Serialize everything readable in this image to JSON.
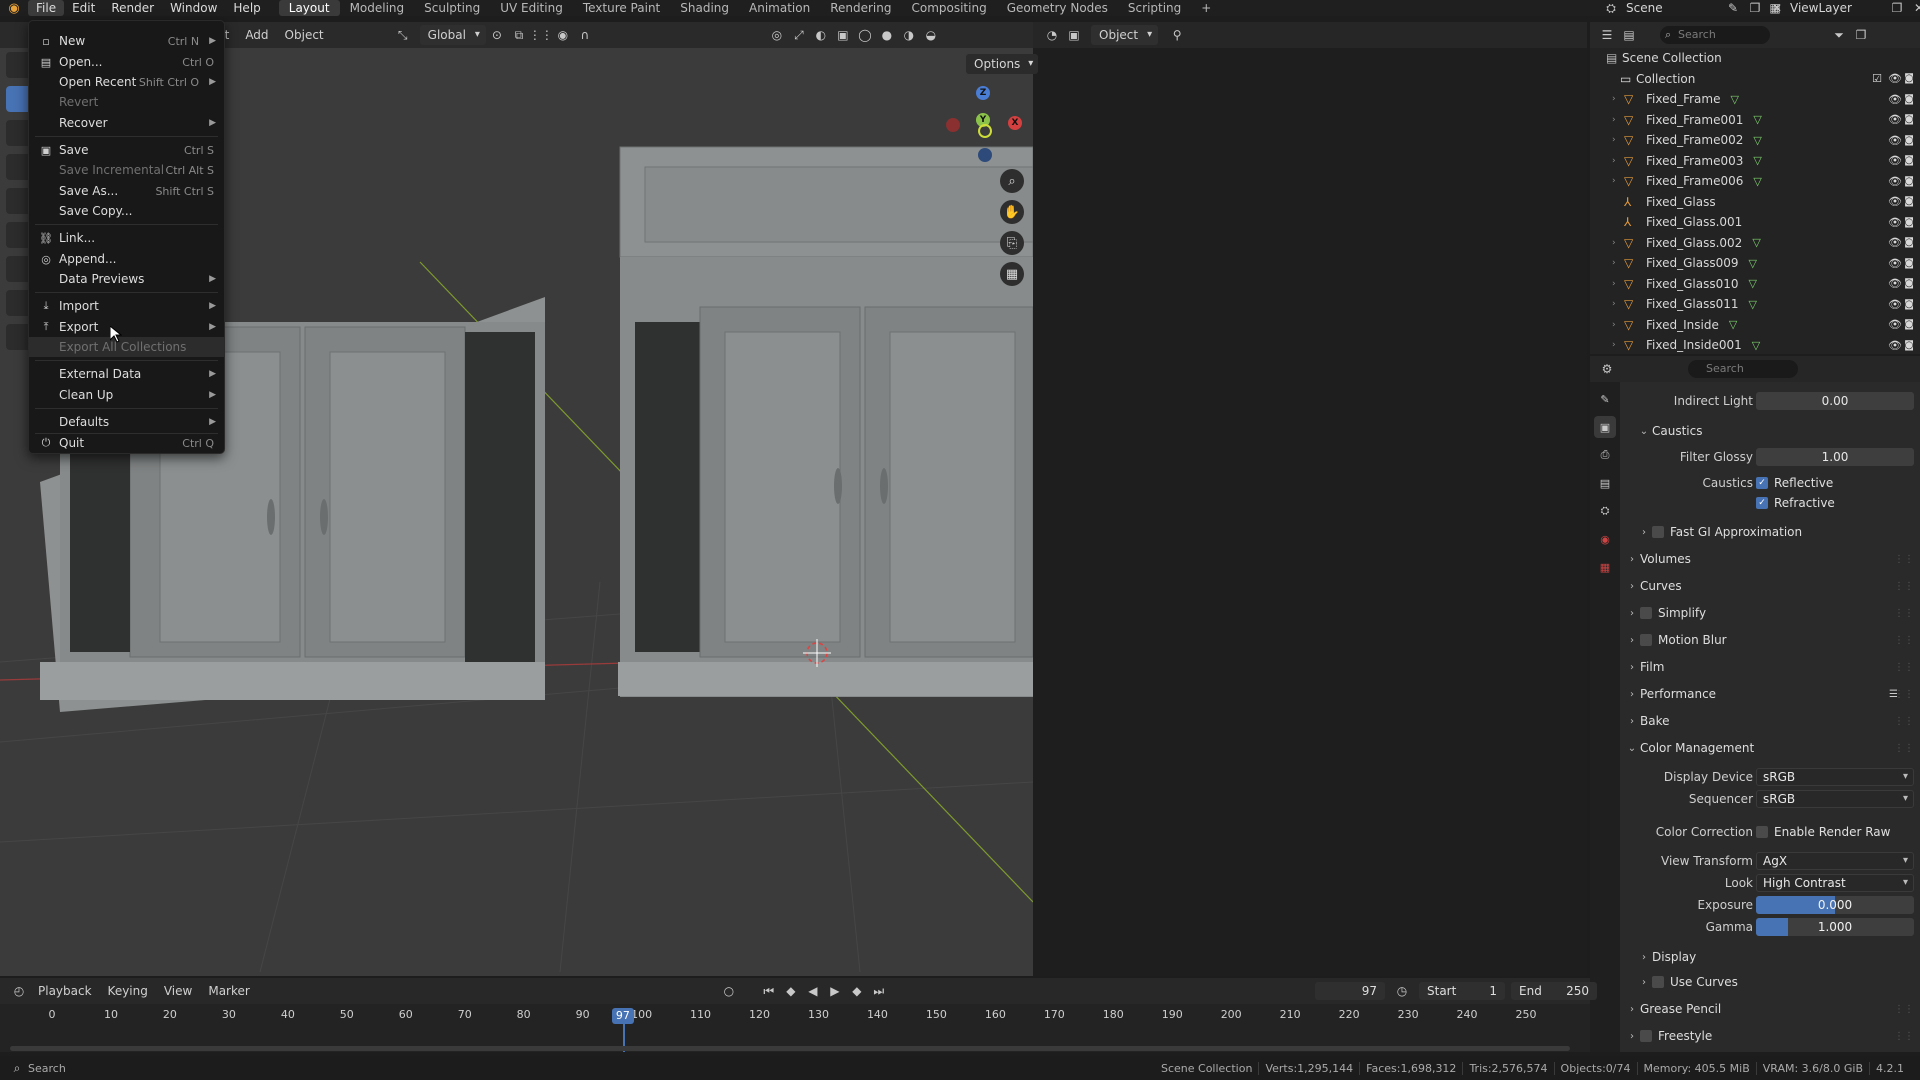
{
  "topbar": {
    "menus": [
      "File",
      "Edit",
      "Render",
      "Window",
      "Help"
    ],
    "workspaces": [
      "Layout",
      "Modeling",
      "Sculpting",
      "UV Editing",
      "Texture Paint",
      "Shading",
      "Animation",
      "Rendering",
      "Compositing",
      "Geometry Nodes",
      "Scripting"
    ],
    "active_workspace": "Layout",
    "add_tab": "+",
    "scene": "Scene",
    "view_layer": "ViewLayer"
  },
  "viewport": {
    "menus": [
      "ct",
      "Add",
      "Object"
    ],
    "transform_orientation": "Global",
    "mode": "Object",
    "options_label": "Options",
    "gizmo": {
      "x": "X",
      "y": "Y",
      "z": "Z"
    }
  },
  "file_menu": {
    "items": [
      {
        "label": "New",
        "shortcut": "Ctrl N",
        "icon": "▫",
        "submenu": true,
        "disabled": false
      },
      {
        "label": "Open...",
        "shortcut": "Ctrl O",
        "icon": "▤",
        "submenu": false,
        "disabled": false
      },
      {
        "label": "Open Recent",
        "shortcut": "Shift Ctrl O",
        "icon": "",
        "submenu": true,
        "disabled": false
      },
      {
        "label": "Revert",
        "shortcut": "",
        "icon": "",
        "submenu": false,
        "disabled": true
      },
      {
        "label": "Recover",
        "shortcut": "",
        "icon": "",
        "submenu": true,
        "disabled": false
      },
      {
        "label": "Save",
        "shortcut": "Ctrl S",
        "icon": "▣",
        "submenu": false,
        "disabled": false
      },
      {
        "label": "Save Incremental",
        "shortcut": "Ctrl Alt S",
        "icon": "",
        "submenu": false,
        "disabled": true
      },
      {
        "label": "Save As...",
        "shortcut": "Shift Ctrl S",
        "icon": "",
        "submenu": false,
        "disabled": false
      },
      {
        "label": "Save Copy...",
        "shortcut": "",
        "icon": "",
        "submenu": false,
        "disabled": false
      },
      {
        "label": "Link...",
        "shortcut": "",
        "icon": "⛓",
        "submenu": false,
        "disabled": false
      },
      {
        "label": "Append...",
        "shortcut": "",
        "icon": "◎",
        "submenu": false,
        "disabled": false
      },
      {
        "label": "Data Previews",
        "shortcut": "",
        "icon": "",
        "submenu": true,
        "disabled": false
      },
      {
        "label": "Import",
        "shortcut": "",
        "icon": "⤓",
        "submenu": true,
        "disabled": false
      },
      {
        "label": "Export",
        "shortcut": "",
        "icon": "⤒",
        "submenu": true,
        "disabled": false
      },
      {
        "label": "Export All Collections",
        "shortcut": "",
        "icon": "",
        "submenu": false,
        "disabled": true
      },
      {
        "label": "External Data",
        "shortcut": "",
        "icon": "",
        "submenu": true,
        "disabled": false
      },
      {
        "label": "Clean Up",
        "shortcut": "",
        "icon": "",
        "submenu": true,
        "disabled": false
      },
      {
        "label": "Defaults",
        "shortcut": "",
        "icon": "",
        "submenu": true,
        "disabled": false
      },
      {
        "label": "Quit",
        "shortcut": "Ctrl Q",
        "icon": "⏻",
        "submenu": false,
        "disabled": false
      }
    ]
  },
  "outliner": {
    "search_placeholder": "Search",
    "scene_collection": "Scene Collection",
    "collection": "Collection",
    "objects": [
      {
        "name": "Fixed_Frame",
        "type": "mesh",
        "modifier": true
      },
      {
        "name": "Fixed_Frame001",
        "type": "mesh",
        "modifier": true
      },
      {
        "name": "Fixed_Frame002",
        "type": "mesh",
        "modifier": true
      },
      {
        "name": "Fixed_Frame003",
        "type": "mesh",
        "modifier": true
      },
      {
        "name": "Fixed_Frame006",
        "type": "mesh",
        "modifier": true
      },
      {
        "name": "Fixed_Glass",
        "type": "empty",
        "modifier": false
      },
      {
        "name": "Fixed_Glass.001",
        "type": "empty",
        "modifier": false
      },
      {
        "name": "Fixed_Glass.002",
        "type": "mesh",
        "modifier": true
      },
      {
        "name": "Fixed_Glass009",
        "type": "mesh",
        "modifier": true
      },
      {
        "name": "Fixed_Glass010",
        "type": "mesh",
        "modifier": true
      },
      {
        "name": "Fixed_Glass011",
        "type": "mesh",
        "modifier": true
      },
      {
        "name": "Fixed_Inside",
        "type": "mesh",
        "modifier": true
      },
      {
        "name": "Fixed_Inside001",
        "type": "mesh",
        "modifier": true
      }
    ]
  },
  "properties": {
    "search_placeholder": "Search",
    "indirect_light_label": "Indirect Light",
    "indirect_light": "0.00",
    "caustics_section": "Caustics",
    "filter_glossy_label": "Filter Glossy",
    "filter_glossy": "1.00",
    "caustics_label": "Caustics",
    "reflective": "Reflective",
    "refractive": "Refractive",
    "fast_gi": "Fast GI Approximation",
    "sections": [
      "Volumes",
      "Curves",
      "Simplify",
      "Motion Blur",
      "Film",
      "Performance",
      "Bake"
    ],
    "color_management": "Color Management",
    "display_device_label": "Display Device",
    "display_device": "sRGB",
    "sequencer_label": "Sequencer",
    "sequencer": "sRGB",
    "color_correction_label": "Color Correction",
    "enable_render_raw": "Enable Render Raw",
    "view_transform_label": "View Transform",
    "view_transform": "AgX",
    "look_label": "Look",
    "look": "High Contrast",
    "exposure_label": "Exposure",
    "exposure": "0.000",
    "exposure_fill": 0.5,
    "gamma_label": "Gamma",
    "gamma": "1.000",
    "gamma_fill": 0.2,
    "display_sub": "Display",
    "use_curves": "Use Curves",
    "grease_pencil": "Grease Pencil",
    "freestyle": "Freestyle"
  },
  "timeline": {
    "menus": [
      "Playback",
      "Keying",
      "View",
      "Marker"
    ],
    "current_frame": "97",
    "start_label": "Start",
    "start": "1",
    "end_label": "End",
    "end": "250",
    "ruler": [
      "0",
      "10",
      "20",
      "30",
      "40",
      "50",
      "60",
      "70",
      "80",
      "90",
      "100",
      "110",
      "120",
      "130",
      "140",
      "150",
      "160",
      "170",
      "180",
      "190",
      "200",
      "210",
      "220",
      "230",
      "240",
      "250"
    ]
  },
  "statusbar": {
    "left": "Search",
    "items": [
      "Scene Collection",
      "Verts:1,295,144",
      "Faces:1,698,312",
      "Tris:2,576,574",
      "Objects:0/74",
      "Memory: 405.5 MiB",
      "VRAM: 3.6/8.0 GiB",
      "4.2.1"
    ]
  },
  "colors": {
    "accent": "#4772b3",
    "mesh_icon": "#e39a3a",
    "modifier_icon": "#7ecf6e",
    "viewport_bg": "#3b3b3b"
  }
}
